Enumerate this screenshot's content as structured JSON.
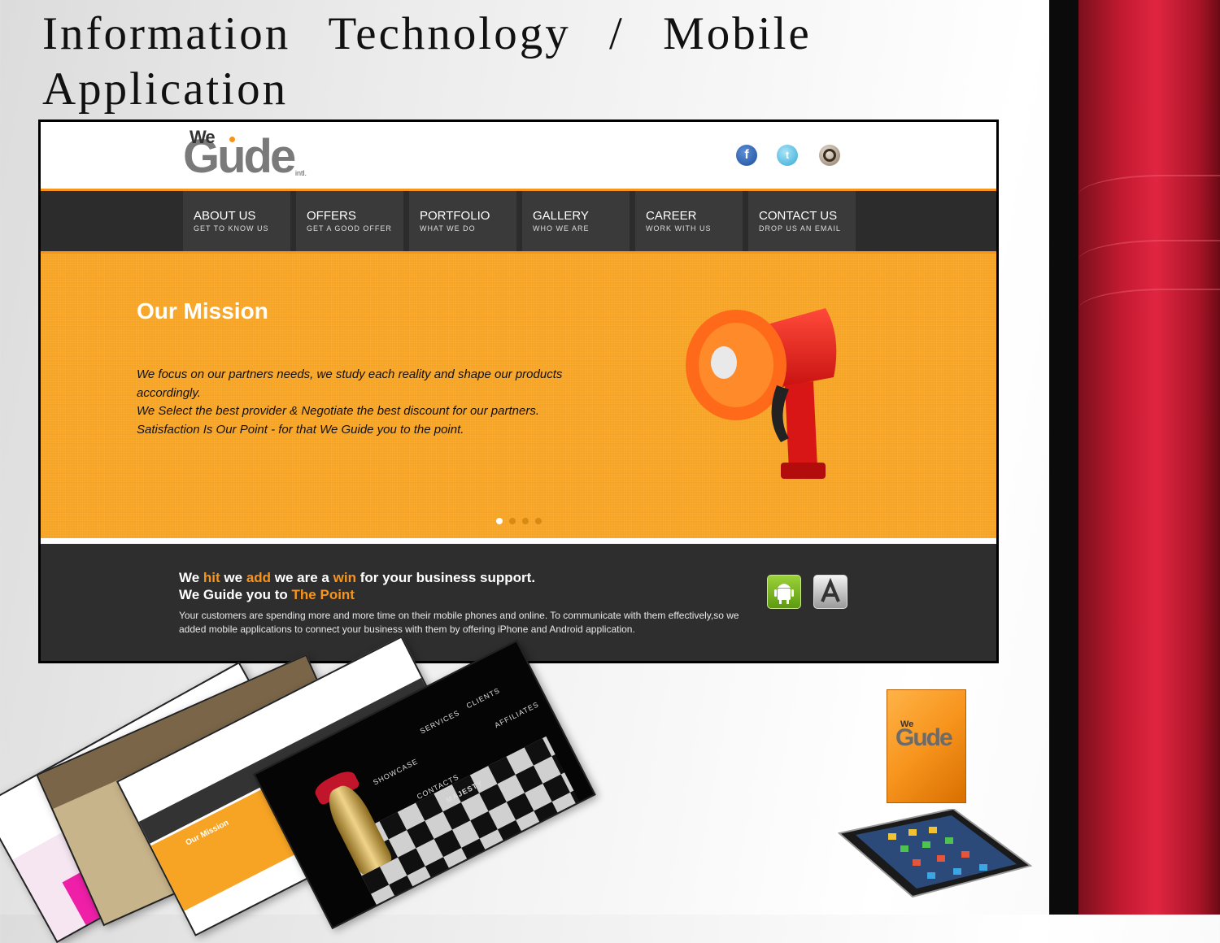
{
  "slide": {
    "title": "Information Technology / Mobile Application"
  },
  "site": {
    "logo": {
      "we": "We",
      "guide": "Gude",
      "intl": "intl."
    },
    "social_icons": [
      "facebook-icon",
      "twitter-icon",
      "instagram-icon"
    ],
    "nav": [
      {
        "title": "ABOUT US",
        "sub": "GET TO KNOW US"
      },
      {
        "title": "OFFERS",
        "sub": "GET A GOOD OFFER"
      },
      {
        "title": "PORTFOLIO",
        "sub": "WHAT WE DO"
      },
      {
        "title": "GALLERY",
        "sub": "WHO WE ARE"
      },
      {
        "title": "CAREER",
        "sub": "WORK WITH US"
      },
      {
        "title": "CONTACT US",
        "sub": "DROP US AN EMAIL"
      }
    ],
    "hero": {
      "title": "Our Mission",
      "lines": [
        "We focus on our partners needs, we study each reality and shape our products accordingly.",
        "We Select the best provider & Negotiate the best discount for our partners.",
        "Satisfaction Is Our Point - for that We Guide you to the point."
      ],
      "slides_total": 4,
      "slide_active": 1
    },
    "footer": {
      "line1": {
        "a": "We ",
        "b": "hit",
        "c": " we ",
        "d": "add",
        "e": " we are a ",
        "f": "win",
        "g": " for your business support."
      },
      "line2": {
        "a": "We Guide you to ",
        "b": "The Point"
      },
      "paragraph": "Your customers are spending more and more time on their mobile phones and online. To communicate with them effectively,so we added mobile applications to connect your business with them by offering iPhone and Android application.",
      "store_icons": [
        "android-icon",
        "app-store-icon"
      ]
    }
  },
  "collage": {
    "card3_title": "Our Mission",
    "card4_labels": [
      "SHOWCASE",
      "SERVICES",
      "CLIENTS",
      "CONTACTS",
      "AFFILIATES",
      "MAJESTY"
    ]
  },
  "book": {
    "we": "We",
    "guide": "Gude"
  },
  "colors": {
    "accent": "#f7941d",
    "hero": "#f7a424",
    "dark": "#2e2e2e",
    "curtain_red": "#c21a30"
  }
}
